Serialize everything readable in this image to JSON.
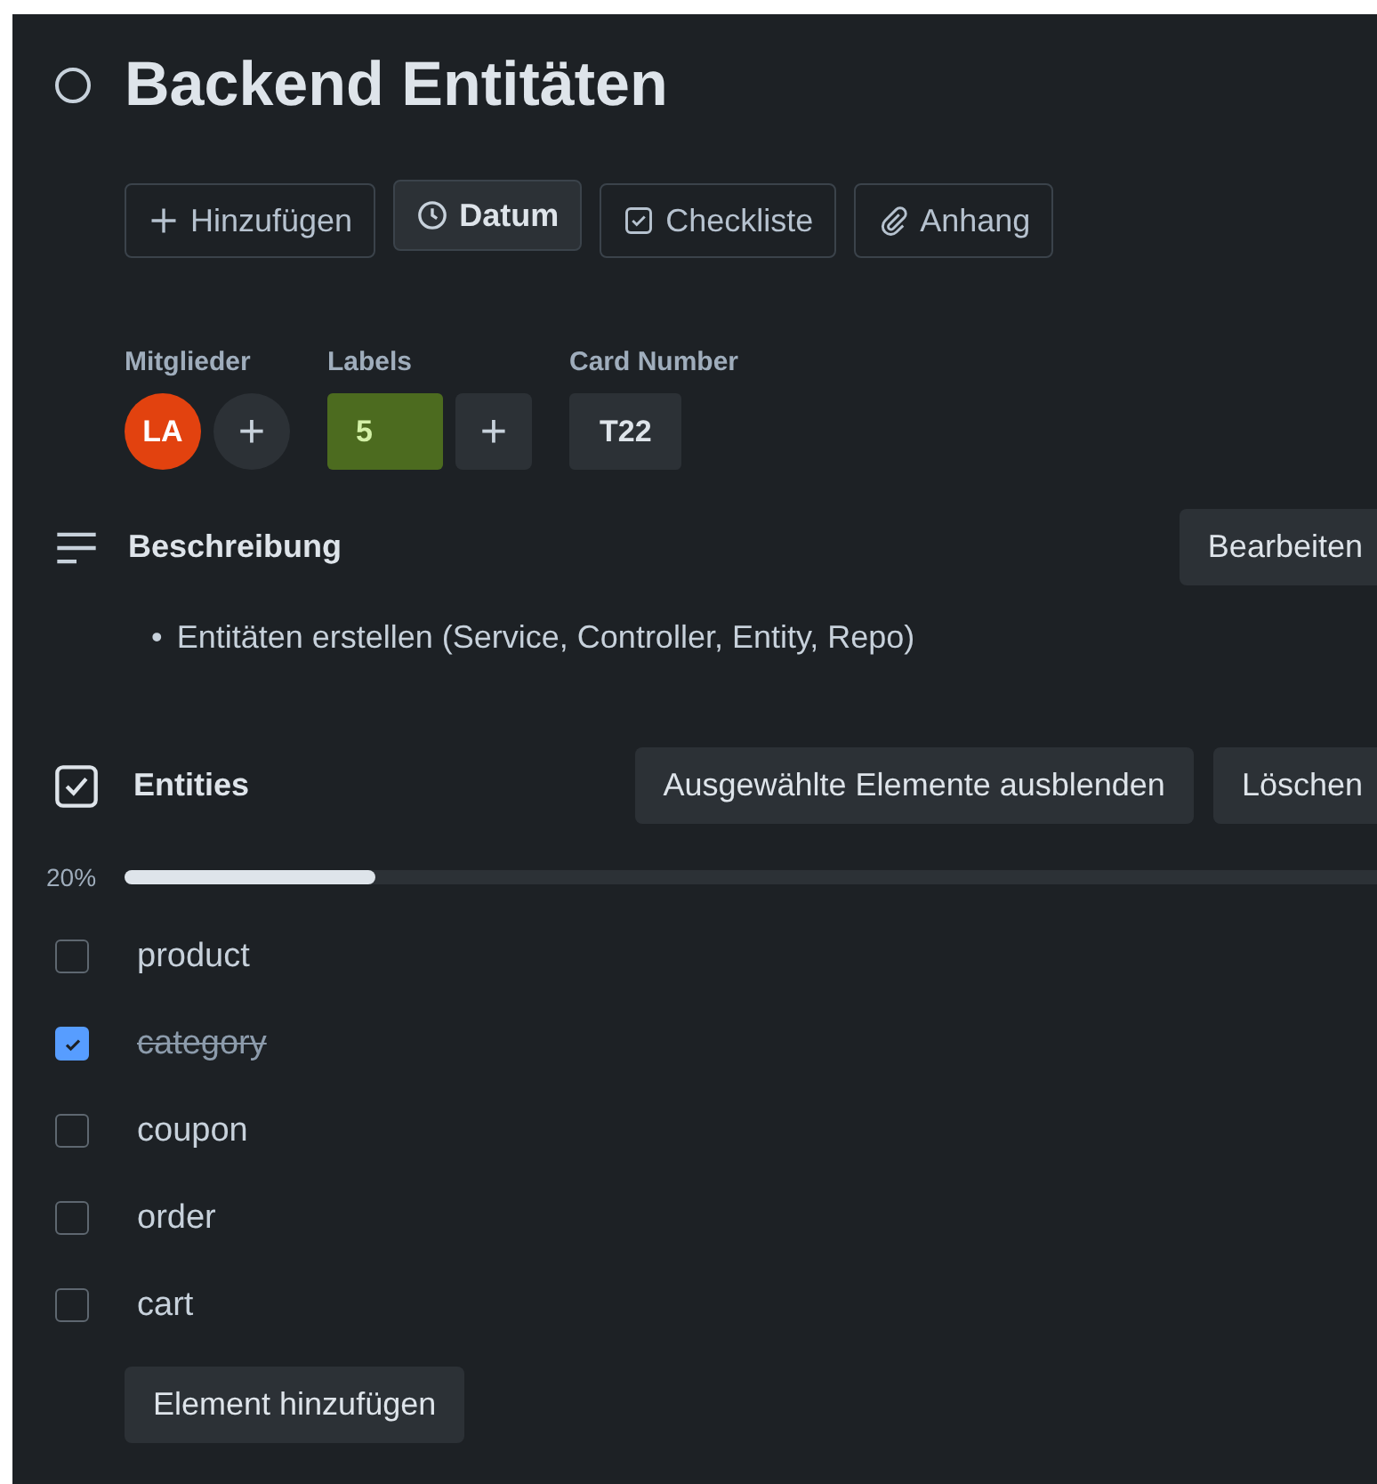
{
  "card": {
    "title": "Backend Entitäten",
    "completed": false
  },
  "actions": [
    {
      "label": "Hinzufügen",
      "kind": "add",
      "active": false
    },
    {
      "label": "Datum",
      "kind": "date",
      "active": true
    },
    {
      "label": "Checkliste",
      "kind": "checklist",
      "active": false
    },
    {
      "label": "Anhang",
      "kind": "attach",
      "active": false
    }
  ],
  "members": {
    "heading": "Mitglieder",
    "avatars": [
      {
        "initials": "LA",
        "color": "#e2420f"
      }
    ],
    "add": "+"
  },
  "labels": {
    "heading": "Labels",
    "items": [
      {
        "text": "5",
        "color": "#4c6b1f"
      }
    ],
    "add": "+"
  },
  "card_number": {
    "heading": "Card Number",
    "value": "T22"
  },
  "description": {
    "heading": "Beschreibung",
    "edit": "Bearbeiten",
    "bullets": [
      {
        "marker": "•",
        "text": "Entitäten erstellen (Service, Controller, Entity, Repo)"
      }
    ]
  },
  "checklist": {
    "title": "Entities",
    "hide": "Ausgewählte Elemente ausblenden",
    "delete": "Löschen",
    "percent": "20%",
    "level": 0.2,
    "items": [
      {
        "text": "product",
        "checked": false
      },
      {
        "text": "category",
        "checked": true
      },
      {
        "text": "coupon",
        "checked": false
      },
      {
        "text": "order",
        "checked": false
      },
      {
        "text": "cart",
        "checked": false
      }
    ],
    "add": "Element hinzufügen"
  }
}
